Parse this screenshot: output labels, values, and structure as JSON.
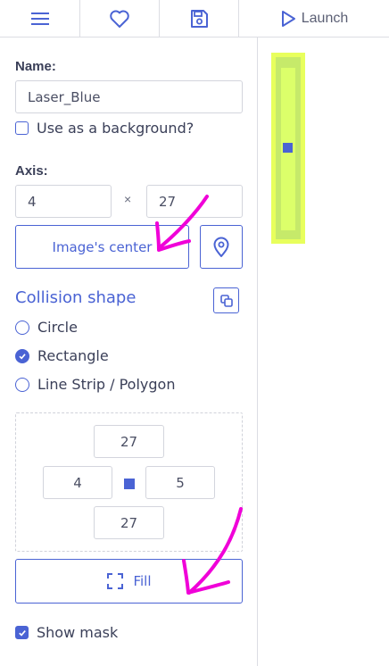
{
  "toolbar": {
    "menu_icon": "hamburger-menu-icon",
    "favorite_icon": "heart-icon",
    "save_icon": "floppy-disk-icon",
    "launch_icon": "play-triangle-icon",
    "launch_label": "Launch"
  },
  "properties": {
    "name_label": "Name:",
    "name_value": "Laser_Blue",
    "background_label": "Use as a background?",
    "background_checked": false,
    "axis_label": "Axis:",
    "axis_x": "4",
    "axis_separator": "×",
    "axis_y": "27",
    "image_center_label": "Image's center",
    "pin_icon": "map-pin-icon"
  },
  "collision": {
    "title": "Collision shape",
    "copy_icon": "copy-icon",
    "shapes": [
      {
        "label": "Circle",
        "selected": false
      },
      {
        "label": "Rectangle",
        "selected": true
      },
      {
        "label": "Line Strip / Polygon",
        "selected": false
      }
    ],
    "offsets": {
      "top": "27",
      "left": "4",
      "right": "5",
      "bottom": "27"
    },
    "fill_label": "Fill",
    "fill_icon": "expand-corners-icon",
    "show_mask_label": "Show mask",
    "show_mask_checked": true
  },
  "colors": {
    "accent": "#4a63d4",
    "annotation": "#f000d8",
    "mask_outer": "#e6ff5a",
    "mask_inner": "#b7e07a"
  }
}
